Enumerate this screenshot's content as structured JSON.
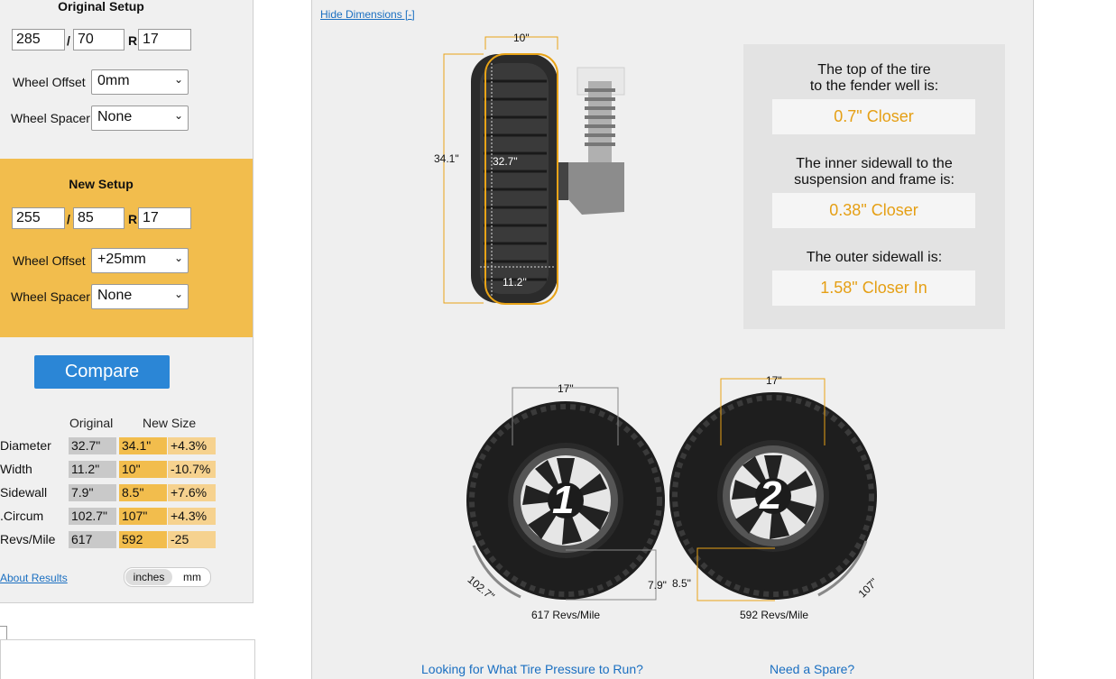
{
  "original": {
    "title": "Original Setup",
    "width": "285",
    "aspect": "70",
    "rim": "17",
    "sep": "/",
    "rim_label": "R",
    "offset_label": "Wheel Offset",
    "offset_value": "0mm",
    "spacer_label": "Wheel Spacer",
    "spacer_value": "None"
  },
  "new_setup": {
    "title": "New Setup",
    "width": "255",
    "aspect": "85",
    "rim": "17",
    "sep": "/",
    "rim_label": "R",
    "offset_label": "Wheel Offset",
    "offset_value": "+25mm",
    "spacer_label": "Wheel Spacer",
    "spacer_value": "None"
  },
  "compare_label": "Compare",
  "results_table": {
    "headers": [
      "Original",
      "New Size"
    ],
    "rows": [
      {
        "label": "Diameter",
        "orig": "32.7\"",
        "new": "34.1\"",
        "diff": "+4.3%"
      },
      {
        "label": "Width",
        "orig": "11.2\"",
        "new": "10\"",
        "diff": "-10.7%"
      },
      {
        "label": "Sidewall",
        "orig": "7.9\"",
        "new": "8.5\"",
        "diff": "+7.6%"
      },
      {
        "label": "Circum.",
        "orig": "102.7\"",
        "new": "107\"",
        "diff": "+4.3%"
      },
      {
        "label": "Revs/Mile",
        "orig": "617",
        "new": "592",
        "diff": "-25"
      }
    ]
  },
  "about_link": "About Results",
  "units": {
    "inches": "inches",
    "mm": "mm"
  },
  "hide_dimensions": "Hide Dimensions [-]",
  "side_view": {
    "width_label": "10\"",
    "new_diameter_label": "34.1\"",
    "orig_diameter_label": "32.7\"",
    "orig_width_label": "11.2\""
  },
  "results": {
    "fender_title_1": "The top of the tire",
    "fender_title_2": "to the fender well is:",
    "fender_value": "0.7\" Closer",
    "inner_title_1": "The inner sidewall to the",
    "inner_title_2": "suspension and frame is:",
    "inner_value": "0.38\" Closer",
    "outer_title": "The outer sidewall is:",
    "outer_value": "1.58\" Closer In"
  },
  "wheel1": {
    "rim": "17\"",
    "number": "1",
    "circ": "102.7\"",
    "sidewall": "7.9\"",
    "revs": "617 Revs/Mile"
  },
  "wheel2": {
    "rim": "17\"",
    "number": "2",
    "circ": "107\"",
    "sidewall": "8.5\"",
    "revs": "592 Revs/Mile"
  },
  "footer": {
    "pressure_link": "Looking for What Tire Pressure to Run?",
    "spare_link": "Need a Spare?"
  },
  "colors": {
    "accent": "#f2bd4d",
    "button": "#2b86d6",
    "link": "#1a6fc1",
    "highlight": "#e59f14"
  }
}
